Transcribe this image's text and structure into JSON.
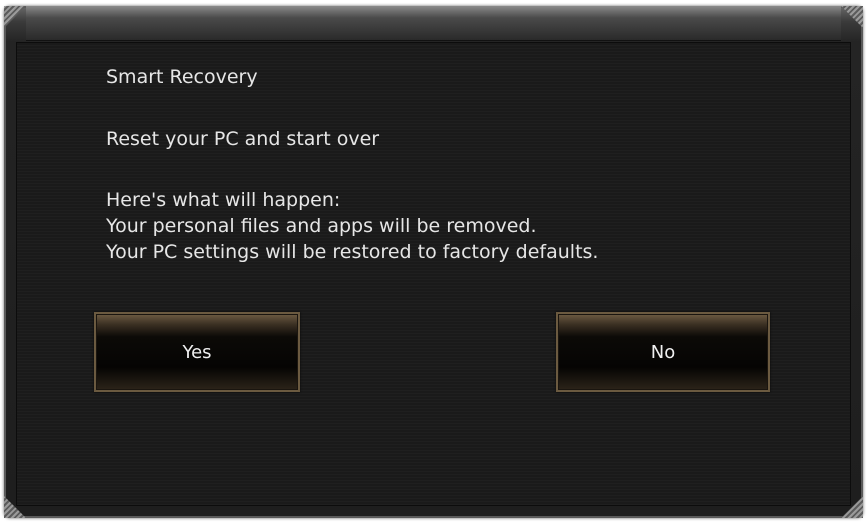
{
  "dialog": {
    "title": "Smart Recovery",
    "subtitle": "Reset your PC and start over",
    "description": [
      "Here's what will happen:",
      "Your personal files and apps will be removed.",
      "Your PC settings will be restored to factory defaults."
    ],
    "yes_label": "Yes",
    "no_label": "No"
  },
  "colors": {
    "panel_background": "#1a1a1a",
    "frame": "#3b3b3b",
    "text": "#e6e6e6",
    "button_border": "#6b5a40"
  }
}
